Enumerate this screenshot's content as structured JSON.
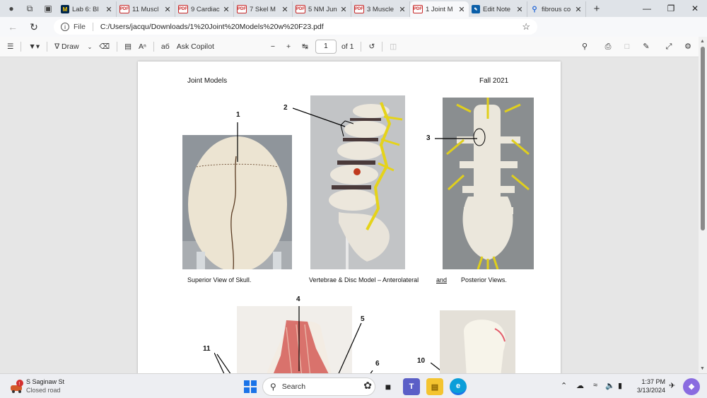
{
  "tabs": [
    {
      "label": "Lab 6: Bl",
      "icon": "michigan-favicon",
      "active": false
    },
    {
      "label": "11 Muscl",
      "icon": "pdf-favicon",
      "active": false
    },
    {
      "label": "9 Cardiac",
      "icon": "pdf-favicon",
      "active": false
    },
    {
      "label": "7 Skel M",
      "icon": "pdf-favicon",
      "active": false
    },
    {
      "label": "5 NM Jun",
      "icon": "pdf-favicon",
      "active": false
    },
    {
      "label": "3 Muscle",
      "icon": "pdf-favicon",
      "active": false
    },
    {
      "label": "1 Joint M",
      "icon": "pdf-favicon",
      "active": true
    },
    {
      "label": "Edit Note",
      "icon": "edit-favicon",
      "active": false
    },
    {
      "label": "fibrous co",
      "icon": "search-favicon",
      "active": false
    }
  ],
  "address": {
    "scheme_label": "File",
    "url": "C:/Users/jacqu/Downloads/1%20Joint%20Models%20w%20F23.pdf"
  },
  "pdf_toolbar": {
    "draw_label": "Draw",
    "copilot_label": "Ask Copilot",
    "page_number": "1",
    "page_total": "of 1"
  },
  "document": {
    "header_left": "Joint Models",
    "header_right": "Fall 2021",
    "caption_skull": "Superior View of Skull.",
    "caption_vertebrae": "Vertebrae & Disc Model – Anterolateral",
    "caption_and": "and",
    "caption_posterior": "Posterior Views.",
    "labels": {
      "n1": "1",
      "n2": "2",
      "n3": "3",
      "n4": "4",
      "n5": "5",
      "n6": "6",
      "n10": "10",
      "n11": "11"
    }
  },
  "taskbar": {
    "weather_title": "S Saginaw St",
    "weather_sub": "Closed road",
    "search_placeholder": "Search",
    "time": "1:37 PM",
    "date": "3/13/2024"
  }
}
